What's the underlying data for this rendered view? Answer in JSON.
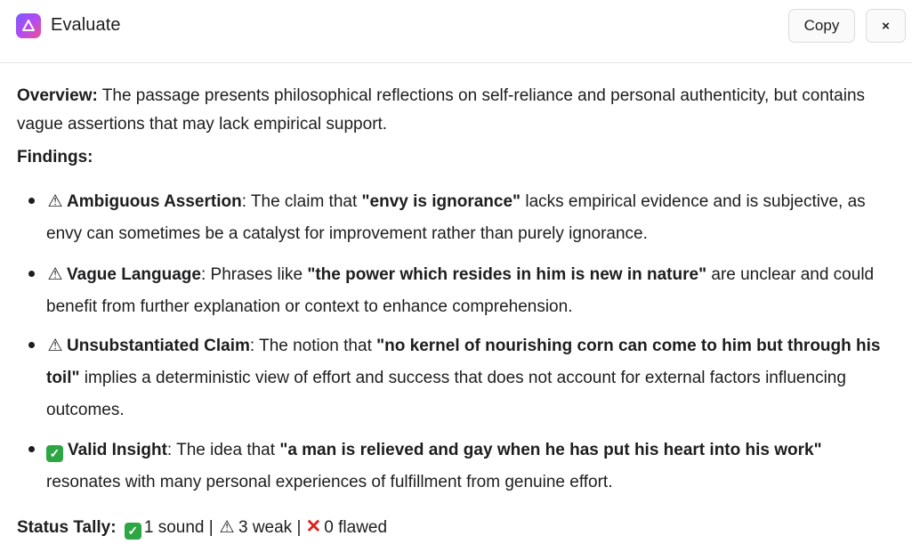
{
  "window": {
    "title": "Evaluate",
    "copy_label": "Copy",
    "close_label": "×"
  },
  "overview": {
    "label": "Overview:",
    "text": "The passage presents philosophical reflections on self-reliance and personal authenticity, but contains vague assertions that may lack empirical support."
  },
  "findings": {
    "heading": "Findings:",
    "items": [
      {
        "icon": "⚠",
        "type": "warning",
        "title": "Ambiguous Assertion",
        "pre": ": The claim that ",
        "quote": "\"envy is ignorance\"",
        "post": " lacks empirical evidence and is subjective, as envy can sometimes be a catalyst for improvement rather than purely ignorance."
      },
      {
        "icon": "⚠",
        "type": "warning",
        "title": "Vague Language",
        "pre": ": Phrases like ",
        "quote": "\"the power which resides in him is new in nature\"",
        "post": " are unclear and could benefit from further explanation or context to enhance comprehension."
      },
      {
        "icon": "⚠",
        "type": "warning",
        "title": "Unsubstantiated Claim",
        "pre": ": The notion that ",
        "quote": "\"no kernel of nourishing corn can come to him but through his toil\"",
        "post": " implies a deterministic view of effort and success that does not account for external factors influencing outcomes."
      },
      {
        "icon": "✓",
        "type": "valid",
        "title": "Valid Insight",
        "pre": ": The idea that ",
        "quote": "\"a man is relieved and gay when he has put his heart into his work\"",
        "post": " resonates with many personal experiences of fulfillment from genuine effort."
      }
    ]
  },
  "tally": {
    "label": "Status Tally:",
    "sound": "1 sound",
    "sep1": " | ",
    "weak": "3 weak",
    "sep2": " | ",
    "flawed": "0 flawed",
    "check_icon": "✓",
    "warning_icon": "⚠",
    "cross_icon": "✕"
  },
  "colors": {
    "valid": "#2ca744",
    "flawed": "#e0201c",
    "logo_gradient": [
      "#7b5cff",
      "#b24bf3",
      "#f0508f"
    ]
  }
}
